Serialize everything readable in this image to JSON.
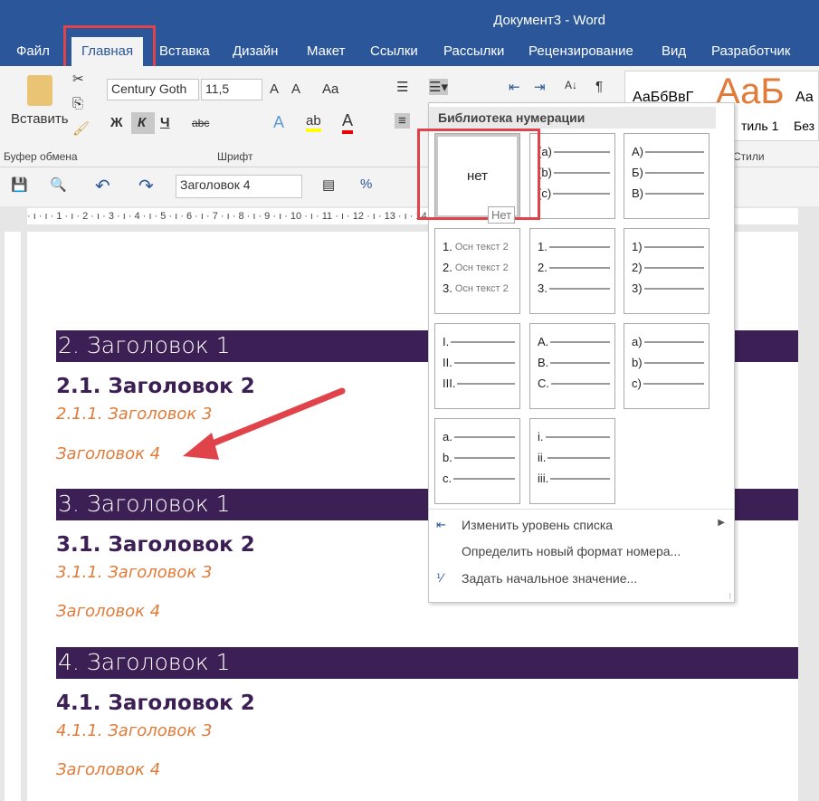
{
  "window": {
    "title": "Документ3 - Word"
  },
  "tabs": [
    "Файл",
    "Главная",
    "Вставка",
    "Дизайн",
    "Макет",
    "Ссылки",
    "Рассылки",
    "Рецензирование",
    "Вид",
    "Разработчик"
  ],
  "ribbon": {
    "clipboard": {
      "paste": "Вставить",
      "label": "Буфер обмена"
    },
    "font": {
      "name": "Century Goth",
      "size": "11,5",
      "label": "Шрифт",
      "bold": "Ж",
      "italic": "К",
      "underline": "Ч",
      "strike": "abc"
    },
    "styles": {
      "label": "Стили",
      "previews": [
        "АаБбВвГ",
        "АаБ",
        "Аа"
      ],
      "names": [
        "тиль 1",
        "Без"
      ]
    }
  },
  "qat": {
    "style_value": "Заголовок 4"
  },
  "ruler": "· ı · ı · 1 · ı · 2 · ı · 3 · ı · 4 · ı · 5 · ı · 6 · ı · 7 · ı · 8 · ı · 9 · ı · 10 · ı · 11 · ı · 12 · ı · 13 · ı · 14 · ı · 15 · ı ·",
  "document": {
    "sections": [
      {
        "h1": "2.  Заголовок 1",
        "h2": "2.1. Заголовок 2",
        "h3": "2.1.1.  Заголовок 3",
        "h4": "Заголовок 4"
      },
      {
        "h1": "3.  Заголовок 1",
        "h2": "3.1. Заголовок 2",
        "h3": "3.1.1.  Заголовок 3",
        "h4": "Заголовок 4"
      },
      {
        "h1": "4.  Заголовок 1",
        "h2": "4.1. Заголовок 2",
        "h3": "4.1.1.  Заголовок 3",
        "h4": "Заголовок 4"
      }
    ]
  },
  "numbering_menu": {
    "header": "Библиотека нумерации",
    "none_label": "нет",
    "tooltip": "Нет",
    "formats": [
      [
        "(a)",
        "(b)",
        "(c)"
      ],
      [
        "A)",
        "Б)",
        "В)"
      ],
      [
        "1.",
        "2.",
        "3."
      ],
      [
        "1.",
        "2.",
        "3."
      ],
      [
        "1)",
        "2)",
        "3)"
      ],
      [
        "I.",
        "II.",
        "III."
      ],
      [
        "A.",
        "B.",
        "C."
      ],
      [
        "a)",
        "b)",
        "c)"
      ],
      [
        "a.",
        "b.",
        "c."
      ],
      [
        "i.",
        "ii.",
        "iii."
      ]
    ],
    "sample_text": "Осн текст 2",
    "items": [
      "Изменить уровень списка",
      "Определить новый формат номера...",
      "Задать начальное значение..."
    ]
  },
  "colors": {
    "brand": "#2b579a",
    "heading1_bg": "#3c1f54",
    "heading_accent": "#e07b39",
    "highlight": "#e0444a"
  }
}
